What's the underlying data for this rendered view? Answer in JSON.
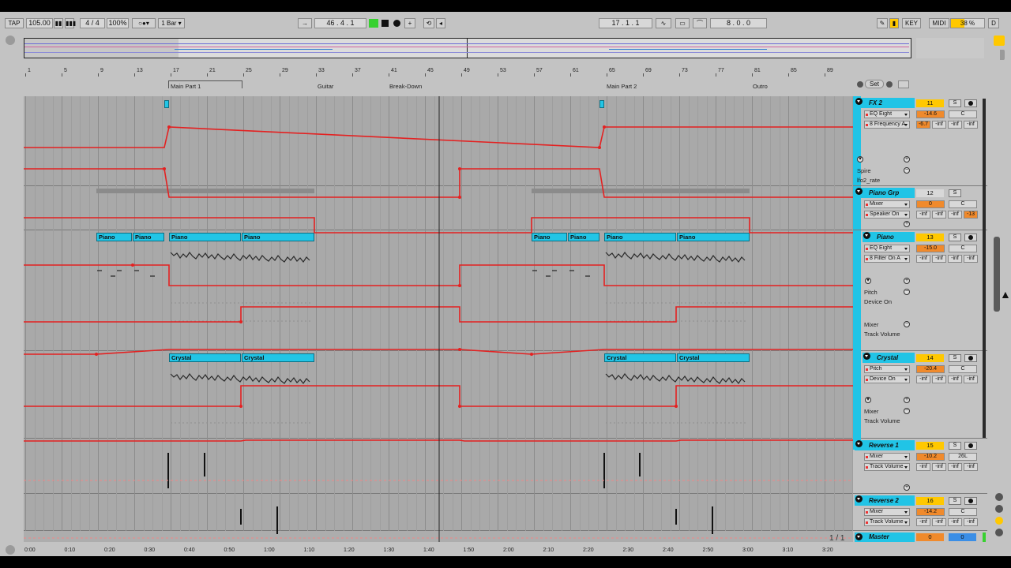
{
  "colors": {
    "accent": "#ffc800",
    "clip": "#22c5e6",
    "automation": "#e42121",
    "track_bg": "#a9a9a9"
  },
  "transport": {
    "tap": "TAP",
    "tempo": "105.00",
    "signature": "4 / 4",
    "zoom": "100%",
    "quantize": "1 Bar",
    "position": "46 . 4 . 1",
    "loop_start": "17 . 1 . 1",
    "loop_length": "8 . 0 . 0",
    "key": "KEY",
    "midi": "MIDI",
    "cpu": "38 %",
    "d": "D"
  },
  "ruler": {
    "bars": [
      "1",
      "5",
      "9",
      "13",
      "17",
      "21",
      "25",
      "29",
      "33",
      "37",
      "41",
      "45",
      "49",
      "53",
      "57",
      "61",
      "65",
      "69",
      "73",
      "77",
      "81",
      "85",
      "89"
    ]
  },
  "locators": [
    "Main Part 1",
    "Guitar",
    "Break-Down",
    "Main Part 2",
    "Outro"
  ],
  "set_label": "Set",
  "clips": {
    "piano": "Piano",
    "crystal": "Crystal"
  },
  "tracks": {
    "fx2": {
      "name": "FX 2",
      "num": "11",
      "solo": "S",
      "device1": "EQ Eight",
      "param1": "8 Frequency A",
      "val1": "-14.6",
      "pan1": "C",
      "val2": "-6.7",
      "inf": "-inf",
      "synth_device": "Spire",
      "synth_param": "lfo2_rate"
    },
    "piano_grp": {
      "name": "Piano Grp",
      "num": "12",
      "solo": "S",
      "device1": "Mixer",
      "param1": "Speaker On",
      "val1": "0",
      "pan1": "C",
      "inf": "-inf",
      "val2": "-13"
    },
    "piano": {
      "name": "Piano",
      "num": "13",
      "solo": "S",
      "device1": "EQ Eight",
      "param1": "8 Filter On A",
      "val1": "-15.0",
      "pan1": "C",
      "inf": "-inf",
      "lane2_device": "Pitch",
      "lane2_param": "Device On",
      "lane3_device": "Mixer",
      "lane3_param": "Track Volume"
    },
    "crystal": {
      "name": "Crystal",
      "num": "14",
      "solo": "S",
      "device1": "Pitch",
      "param1": "Device On",
      "val1": "-20.4",
      "pan1": "C",
      "inf": "-inf",
      "lane2_device": "Mixer",
      "lane2_param": "Track Volume"
    },
    "reverse1": {
      "name": "Reverse 1",
      "num": "15",
      "solo": "S",
      "device1": "Mixer",
      "param1": "Track Volume",
      "val1": "-10.2",
      "pan1": "26L",
      "inf": "-inf"
    },
    "reverse2": {
      "name": "Reverse 2",
      "num": "16",
      "solo": "S",
      "device1": "Mixer",
      "param1": "Track Volume",
      "val1": "-14.2",
      "pan1": "C",
      "inf": "-inf"
    },
    "master": {
      "name": "Master",
      "num": "0",
      "val": "0"
    }
  },
  "footer": {
    "times": [
      "0:00",
      "0:10",
      "0:20",
      "0:30",
      "0:40",
      "0:50",
      "1:00",
      "1:10",
      "1:20",
      "1:30",
      "1:40",
      "1:50",
      "2:00",
      "2:10",
      "2:20",
      "2:30",
      "2:40",
      "2:50",
      "3:00",
      "3:10",
      "3:20"
    ],
    "page": "1 / 1"
  }
}
